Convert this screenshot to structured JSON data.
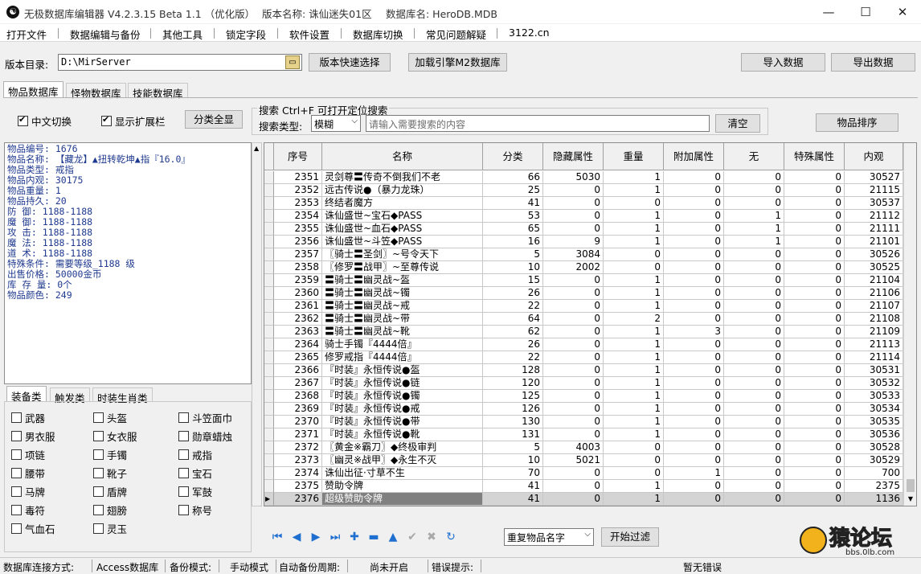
{
  "titlebar": {
    "app": "无极数据库编辑器 V4.2.3.15",
    "beta": "Beta 1.1 （优化版）",
    "version_name": "版本名称: 诛仙迷失01区",
    "db_name": "数据库名: HeroDB.MDB",
    "minimize": "—",
    "maximize": "☐",
    "close": "✕"
  },
  "menu": [
    "打开文件",
    "数据编辑与备份",
    "其他工具",
    "锁定字段",
    "软件设置",
    "数据库切换",
    "常见问题解疑",
    "3122.cn"
  ],
  "toolbar": {
    "dir_label": "版本目录:",
    "dir_value": "D:\\MirServer",
    "quick_select": "版本快速选择",
    "load_engine": "加载引擎M2数据库",
    "import": "导入数据",
    "export": "导出数据"
  },
  "tabs": [
    "物品数据库",
    "怪物数据库",
    "技能数据库"
  ],
  "options": {
    "cn_switch": "中文切换",
    "show_ext": "显示扩展栏",
    "category_all": "分类全显",
    "search_title": "搜索   Ctrl+F 可打开定位搜索",
    "search_type_label": "搜索类型:",
    "search_type_value": "模糊",
    "search_placeholder": "请输入需要搜索的内容",
    "clear": "清空",
    "sort": "物品排序"
  },
  "info": [
    "物品编号: 1676",
    "物品名称: 【藏龙】▲扭转乾坤▲指『16.0』",
    "物品类型: 戒指",
    "物品内观: 30175",
    "物品重量: 1",
    "物品持久: 20",
    "防    御: 1188-1188",
    "魔    御: 1188-1188",
    "攻    击: 1188-1188",
    "魔    法: 1188-1188",
    "道    术: 1188-1188",
    "特殊条件: 需要等级_1188 级",
    "出售价格: 50000金币",
    "库 存 量: 0个",
    "物品颜色: 249"
  ],
  "subtabs": [
    "装备类",
    "触发类",
    "时装生肖类"
  ],
  "equip_checks": [
    [
      "武器",
      "头盔",
      "斗笠面巾"
    ],
    [
      "男衣服",
      "女衣服",
      "勋章蜡烛"
    ],
    [
      "项链",
      "手镯",
      "戒指"
    ],
    [
      "腰带",
      "靴子",
      "宝石"
    ],
    [
      "马牌",
      "盾牌",
      "军鼓"
    ],
    [
      "毒符",
      "翅膀",
      "称号"
    ],
    [
      "气血石",
      "灵玉",
      ""
    ]
  ],
  "grid": {
    "columns": [
      "序号",
      "名称",
      "分类",
      "隐藏属性",
      "重量",
      "附加属性",
      "无",
      "特殊属性",
      "内观"
    ],
    "rows": [
      [
        "2351",
        "灵剑尊〓传奇不倒我们不老",
        "66",
        "5030",
        "1",
        "0",
        "0",
        "0",
        "30527"
      ],
      [
        "2352",
        "远古传说●（暴力龙珠）",
        "25",
        "0",
        "1",
        "0",
        "0",
        "0",
        "21115"
      ],
      [
        "2353",
        "终结者魔方",
        "41",
        "0",
        "0",
        "0",
        "0",
        "0",
        "30537"
      ],
      [
        "2354",
        "诛仙盛世~宝石◆PASS",
        "53",
        "0",
        "1",
        "0",
        "1",
        "0",
        "21112"
      ],
      [
        "2355",
        "诛仙盛世~血石◆PASS",
        "65",
        "0",
        "1",
        "0",
        "1",
        "0",
        "21111"
      ],
      [
        "2356",
        "诛仙盛世~斗笠◆PASS",
        "16",
        "9",
        "1",
        "0",
        "1",
        "0",
        "21101"
      ],
      [
        "2357",
        "〖骑士〓圣剑〗~号令天下",
        "5",
        "3084",
        "0",
        "0",
        "0",
        "0",
        "30526"
      ],
      [
        "2358",
        "〖修罗〓战甲〗~至尊传说",
        "10",
        "2002",
        "0",
        "0",
        "0",
        "0",
        "30525"
      ],
      [
        "2359",
        "〓骑士〓幽灵战~盔",
        "15",
        "0",
        "1",
        "0",
        "0",
        "0",
        "21104"
      ],
      [
        "2360",
        "〓骑士〓幽灵战~镯",
        "26",
        "0",
        "1",
        "0",
        "0",
        "0",
        "21106"
      ],
      [
        "2361",
        "〓骑士〓幽灵战~戒",
        "22",
        "0",
        "1",
        "0",
        "0",
        "0",
        "21107"
      ],
      [
        "2362",
        "〓骑士〓幽灵战~带",
        "64",
        "0",
        "2",
        "0",
        "0",
        "0",
        "21108"
      ],
      [
        "2363",
        "〓骑士〓幽灵战~靴",
        "62",
        "0",
        "1",
        "3",
        "0",
        "0",
        "21109"
      ],
      [
        "2364",
        "骑士手镯『4444倍』",
        "26",
        "0",
        "1",
        "0",
        "0",
        "0",
        "21113"
      ],
      [
        "2365",
        "修罗戒指『4444倍』",
        "22",
        "0",
        "1",
        "0",
        "0",
        "0",
        "21114"
      ],
      [
        "2366",
        "『时装』永恒传说●盔",
        "128",
        "0",
        "1",
        "0",
        "0",
        "0",
        "30531"
      ],
      [
        "2367",
        "『时装』永恒传说●链",
        "120",
        "0",
        "1",
        "0",
        "0",
        "0",
        "30532"
      ],
      [
        "2368",
        "『时装』永恒传说●镯",
        "125",
        "0",
        "1",
        "0",
        "0",
        "0",
        "30533"
      ],
      [
        "2369",
        "『时装』永恒传说●戒",
        "126",
        "0",
        "1",
        "0",
        "0",
        "0",
        "30534"
      ],
      [
        "2370",
        "『时装』永恒传说●带",
        "130",
        "0",
        "1",
        "0",
        "0",
        "0",
        "30535"
      ],
      [
        "2371",
        "『时装』永恒传说●靴",
        "131",
        "0",
        "1",
        "0",
        "0",
        "0",
        "30536"
      ],
      [
        "2372",
        "〖黄金※霸刀〗◆终极审判",
        "5",
        "4003",
        "0",
        "0",
        "0",
        "0",
        "30528"
      ],
      [
        "2373",
        "〖幽灵※战甲〗◆永生不灭",
        "10",
        "5021",
        "0",
        "0",
        "0",
        "0",
        "30529"
      ],
      [
        "2374",
        "诛仙出征·寸草不生",
        "70",
        "0",
        "0",
        "1",
        "0",
        "0",
        "700"
      ],
      [
        "2375",
        "赞助令牌",
        "41",
        "0",
        "1",
        "0",
        "0",
        "0",
        "2375"
      ],
      [
        "2376",
        "超级赞助令牌",
        "41",
        "0",
        "1",
        "0",
        "0",
        "0",
        "1136"
      ]
    ],
    "current_marker": "▶"
  },
  "bottom": {
    "nav_icons": [
      "first-icon",
      "prev-icon",
      "next-icon",
      "last-icon",
      "add-icon",
      "delete-icon",
      "up-icon",
      "confirm-icon",
      "cancel-icon",
      "refresh-icon"
    ],
    "filter_value": "重复物品名字",
    "filter_button": "开始过滤"
  },
  "status": {
    "conn_label": "数据库连接方式:",
    "conn_value": "Access数据库",
    "backup_label": "备份模式:",
    "backup_value": "手动模式",
    "period_label": "自动备份周期:",
    "period_value": "尚未开启",
    "error_label": "错误提示:",
    "error_value": "暂无错误"
  },
  "watermark": {
    "main": "猿论坛",
    "sub": "bbs.0lb.com"
  },
  "colors": {
    "info_text": "#1f3a8f",
    "nav_blue": "#1f6fd0",
    "selected_row": "#808080"
  }
}
